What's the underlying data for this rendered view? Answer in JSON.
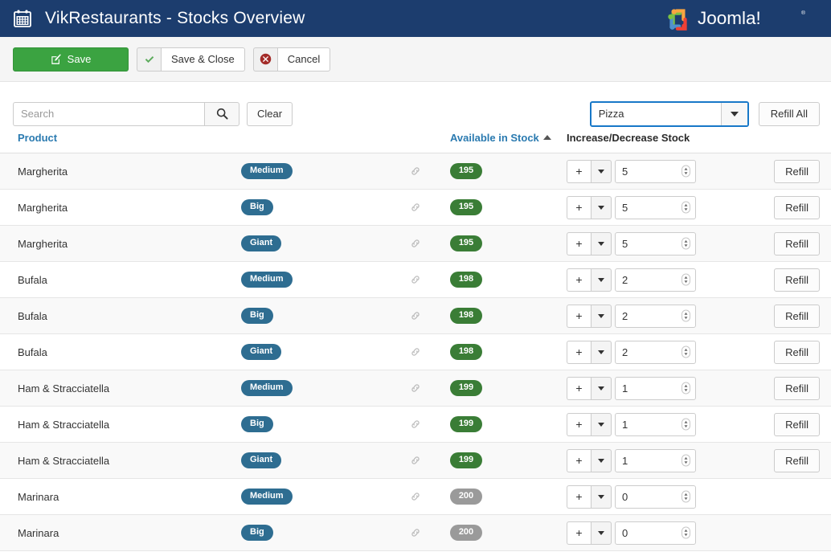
{
  "header": {
    "icon": "calendar-icon",
    "title": "VikRestaurants - Stocks Overview",
    "brand": "Joomla!",
    "brand_colors": {
      "orange": "#f9a541",
      "green": "#7ac143",
      "blue": "#5091cd",
      "red": "#ee4035",
      "bar_bg": "#1c3d6e"
    }
  },
  "toolbar": {
    "save_label": "Save",
    "save_icon": "pencil-square-icon",
    "save_close_label": "Save & Close",
    "save_close_icon": "check-icon",
    "cancel_label": "Cancel",
    "cancel_icon": "times-circle-icon",
    "save_color": "#3ba341"
  },
  "filters": {
    "search_placeholder": "Search",
    "search_value": "",
    "search_icon": "search-icon",
    "clear_label": "Clear",
    "category_selected": "Pizza",
    "category_options": [
      "Pizza"
    ],
    "category_focus_color": "#1878c8",
    "refill_all_label": "Refill All"
  },
  "table": {
    "columns": [
      {
        "label": "Product",
        "link": true,
        "sort": null
      },
      {
        "label": "",
        "link": false,
        "sort": null
      },
      {
        "label": "",
        "link": false,
        "sort": null
      },
      {
        "label": "Available in Stock",
        "link": true,
        "sort": "asc"
      },
      {
        "label": "Increase/Decrease Stock",
        "link": false,
        "sort": null
      },
      {
        "label": "",
        "link": false,
        "sort": null
      }
    ],
    "operator": "+",
    "link_icon": "chain-link-icon",
    "refill_label": "Refill",
    "rows": [
      {
        "product": "Margherita",
        "variant": "Medium",
        "stock": "195",
        "stock_state": "green",
        "amount": "5",
        "refill": true
      },
      {
        "product": "Margherita",
        "variant": "Big",
        "stock": "195",
        "stock_state": "green",
        "amount": "5",
        "refill": true
      },
      {
        "product": "Margherita",
        "variant": "Giant",
        "stock": "195",
        "stock_state": "green",
        "amount": "5",
        "refill": true
      },
      {
        "product": "Bufala",
        "variant": "Medium",
        "stock": "198",
        "stock_state": "green",
        "amount": "2",
        "refill": true
      },
      {
        "product": "Bufala",
        "variant": "Big",
        "stock": "198",
        "stock_state": "green",
        "amount": "2",
        "refill": true
      },
      {
        "product": "Bufala",
        "variant": "Giant",
        "stock": "198",
        "stock_state": "green",
        "amount": "2",
        "refill": true
      },
      {
        "product": "Ham & Stracciatella",
        "variant": "Medium",
        "stock": "199",
        "stock_state": "green",
        "amount": "1",
        "refill": true
      },
      {
        "product": "Ham & Stracciatella",
        "variant": "Big",
        "stock": "199",
        "stock_state": "green",
        "amount": "1",
        "refill": true
      },
      {
        "product": "Ham & Stracciatella",
        "variant": "Giant",
        "stock": "199",
        "stock_state": "green",
        "amount": "1",
        "refill": true
      },
      {
        "product": "Marinara",
        "variant": "Medium",
        "stock": "200",
        "stock_state": "gray",
        "amount": "0",
        "refill": false
      },
      {
        "product": "Marinara",
        "variant": "Big",
        "stock": "200",
        "stock_state": "gray",
        "amount": "0",
        "refill": false
      }
    ]
  }
}
